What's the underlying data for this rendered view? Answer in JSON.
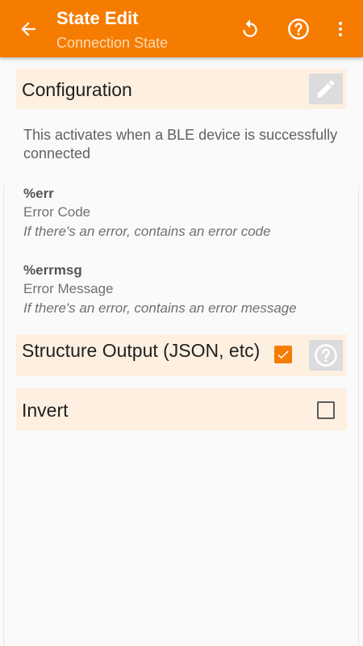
{
  "appbar": {
    "title": "State Edit",
    "subtitle": "Connection State",
    "background_color": "#f57c00",
    "icons": {
      "back": "arrow-back-icon",
      "reset": "reset-icon",
      "help": "help-icon",
      "more": "more-vert-icon"
    }
  },
  "configuration": {
    "label": "Configuration",
    "edit_icon": "pencil-icon"
  },
  "description": "This activates when a BLE device is successfully connected",
  "variables": [
    {
      "name": "%err",
      "title": "Error Code",
      "description": "If there's an error, contains an error code"
    },
    {
      "name": "%errmsg",
      "title": "Error Message",
      "description": "If there's an error, contains an error message"
    }
  ],
  "options": {
    "structure_output": {
      "label": "Structure Output (JSON, etc)",
      "checked": true,
      "help_icon": "help-icon"
    },
    "invert": {
      "label": "Invert",
      "checked": false
    }
  },
  "colors": {
    "accent": "#f57c00",
    "row_background": "#fdf0e1"
  }
}
